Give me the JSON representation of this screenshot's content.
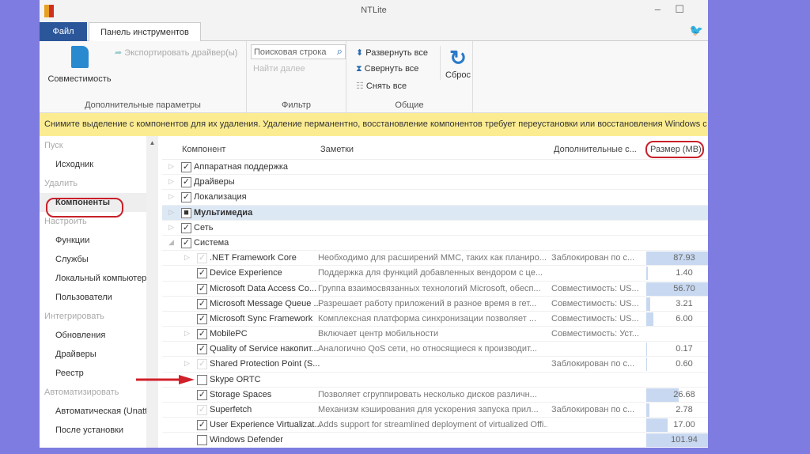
{
  "window": {
    "title": "NTLite"
  },
  "tabs": {
    "file": "Файл",
    "tools": "Панель инструментов"
  },
  "ribbon": {
    "compat": "Совместимость",
    "export": "Экспортировать драйвер(ы)",
    "group1": "Дополнительные параметры",
    "search_placeholder": "Поисковая строка",
    "find_next": "Найти далее",
    "group2": "Фильтр",
    "expand": "Развернуть все",
    "collapse": "Свернуть все",
    "uncheck": "Снять все",
    "reset": "Сброс",
    "group3": "Общие"
  },
  "message": "Снимите выделение с компонентов для их удаления. Удаление перманентно, восстановление компонентов требует переустановки или восстановления Windows с р",
  "sidebar": [
    {
      "t": "h",
      "label": "Пуск"
    },
    {
      "t": "i",
      "label": "Исходник"
    },
    {
      "t": "h",
      "label": "Удалить"
    },
    {
      "t": "i",
      "label": "Компоненты",
      "selected": true
    },
    {
      "t": "h",
      "label": "Настроить"
    },
    {
      "t": "i",
      "label": "Функции"
    },
    {
      "t": "i",
      "label": "Службы"
    },
    {
      "t": "i",
      "label": "Локальный компьютер"
    },
    {
      "t": "i",
      "label": "Пользователи"
    },
    {
      "t": "h",
      "label": "Интегрировать"
    },
    {
      "t": "i",
      "label": "Обновления"
    },
    {
      "t": "i",
      "label": "Драйверы"
    },
    {
      "t": "i",
      "label": "Реестр"
    },
    {
      "t": "h",
      "label": "Автоматизировать"
    },
    {
      "t": "i",
      "label": "Автоматическая (Unattended)"
    },
    {
      "t": "i",
      "label": "После установки"
    }
  ],
  "columns": {
    "component": "Компонент",
    "notes": "Заметки",
    "extra": "Дополнительные с...",
    "size": "Размер (MB)"
  },
  "rows": [
    {
      "lvl": 0,
      "exp": "▷",
      "check": "on",
      "name": "Аппаратная поддержка"
    },
    {
      "lvl": 0,
      "exp": "▷",
      "check": "on",
      "name": "Драйверы"
    },
    {
      "lvl": 0,
      "exp": "▷",
      "check": "on",
      "name": "Локализация"
    },
    {
      "lvl": 0,
      "exp": "▷",
      "check": "partial",
      "name": "Мультимедиа",
      "highlight": true
    },
    {
      "lvl": 0,
      "exp": "▷",
      "check": "on",
      "name": "Сеть"
    },
    {
      "lvl": 0,
      "exp": "◢",
      "check": "on",
      "name": "Система"
    },
    {
      "lvl": 1,
      "exp": "▷",
      "check": "dim",
      "name": ".NET Framework Core",
      "notes": "Необходимо для расширений MMC, таких как планиро...",
      "extra": "Заблокирован по с...",
      "size": "87.93",
      "fill": 1
    },
    {
      "lvl": 1,
      "check": "on",
      "name": "Device Experience",
      "notes": "Поддержка для функций добавленных вендором с це...",
      "size": "1.40",
      "fill": 0.02
    },
    {
      "lvl": 1,
      "check": "on",
      "name": "Microsoft Data Access Co...",
      "notes": "Группа взаимосвязанных технологий Microsoft, обесп...",
      "extra": "Совместимость: US...",
      "size": "56.70",
      "fill": 1
    },
    {
      "lvl": 1,
      "check": "on",
      "name": "Microsoft Message Queue ...",
      "notes": "Разрешает работу приложений в разное время в гет...",
      "extra": "Совместимость: US...",
      "size": "3.21",
      "fill": 0.06
    },
    {
      "lvl": 1,
      "check": "on",
      "name": "Microsoft Sync Framework",
      "notes": "Комплексная платформа синхронизации позволяет ...",
      "extra": "Совместимость: US...",
      "size": "6.00",
      "fill": 0.12
    },
    {
      "lvl": 1,
      "exp": "▷",
      "check": "on",
      "name": "MobilePC",
      "notes": "Включает центр мобильности",
      "extra": "Совместимость: Уст..."
    },
    {
      "lvl": 1,
      "check": "on",
      "name": "Quality of Service накопит...",
      "notes": "Аналогично QoS сети, но относящиеся к производит...",
      "size": "0.17",
      "fill": 0.01
    },
    {
      "lvl": 1,
      "exp": "▷",
      "check": "dim",
      "name": "Shared Protection Point (S...",
      "extra": "Заблокирован по с...",
      "size": "0.60",
      "fill": 0.01
    },
    {
      "lvl": 1,
      "check": "off",
      "name": "Skype ORTC"
    },
    {
      "lvl": 1,
      "check": "on",
      "name": "Storage Spaces",
      "notes": "Позволяет сгруппировать несколько дисков различн...",
      "size": "26.68",
      "fill": 0.53
    },
    {
      "lvl": 1,
      "check": "dim",
      "name": "Superfetch",
      "notes": "Механизм кэширования для ускорения запуска прил...",
      "extra": "Заблокирован по с...",
      "size": "2.78",
      "fill": 0.05
    },
    {
      "lvl": 1,
      "check": "on",
      "name": "User Experience Virtualizat...",
      "notes": "Adds support for streamlined deployment of virtualized Offi...",
      "size": "17.00",
      "fill": 0.34
    },
    {
      "lvl": 1,
      "check": "off",
      "name": "Windows Defender",
      "size": "101.94",
      "fill": 1
    }
  ]
}
